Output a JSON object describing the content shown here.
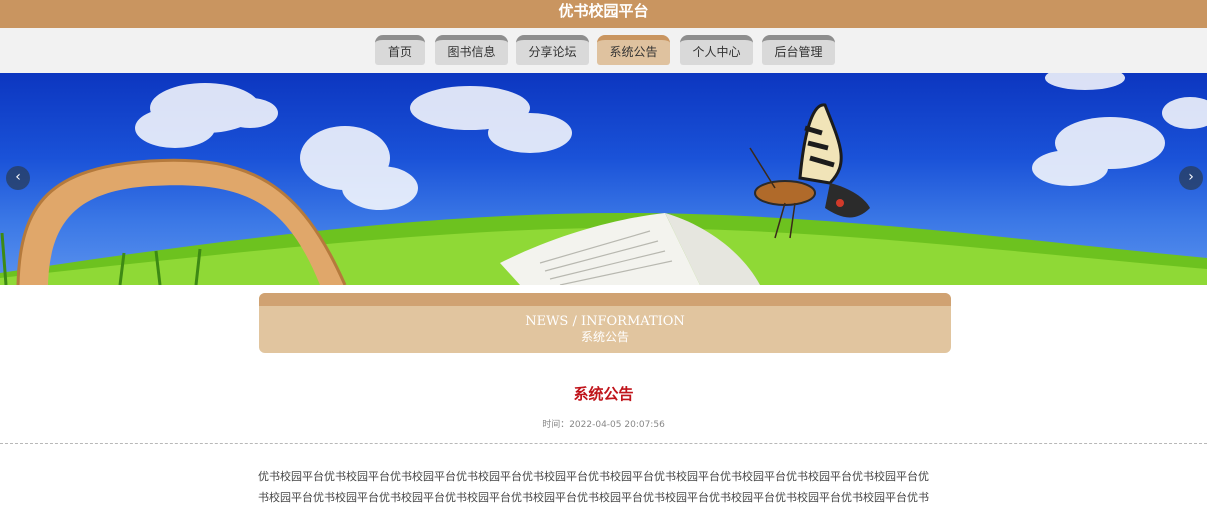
{
  "header": {
    "title": "优书校园平台"
  },
  "nav": {
    "items": [
      {
        "label": "首页"
      },
      {
        "label": "图书信息"
      },
      {
        "label": "分享论坛"
      },
      {
        "label": "系统公告",
        "active": true
      },
      {
        "label": "个人中心"
      },
      {
        "label": "后台管理"
      }
    ]
  },
  "banner": {
    "prev_icon": "chevron-left-icon",
    "next_icon": "chevron-right-icon",
    "prev_glyph": "‹",
    "next_glyph": "›"
  },
  "section": {
    "en": "NEWS / INFORMATION",
    "cn": "系统公告"
  },
  "notice": {
    "title": "系统公告",
    "time": "时间：2022-04-05 20:07:56",
    "body_line1": "优书校园平台优书校园平台优书校园平台优书校园平台优书校园平台优书校园平台优书校园平台优书校园平台优书校园平台优书校园平台优",
    "body_line2": "书校园平台优书校园平台优书校园平台优书校园平台优书校园平台优书校园平台优书校园平台优书校园平台优书校园平台优书校园平台优书"
  },
  "colors": {
    "brand": "#c99560",
    "title_red": "#c0141b"
  }
}
